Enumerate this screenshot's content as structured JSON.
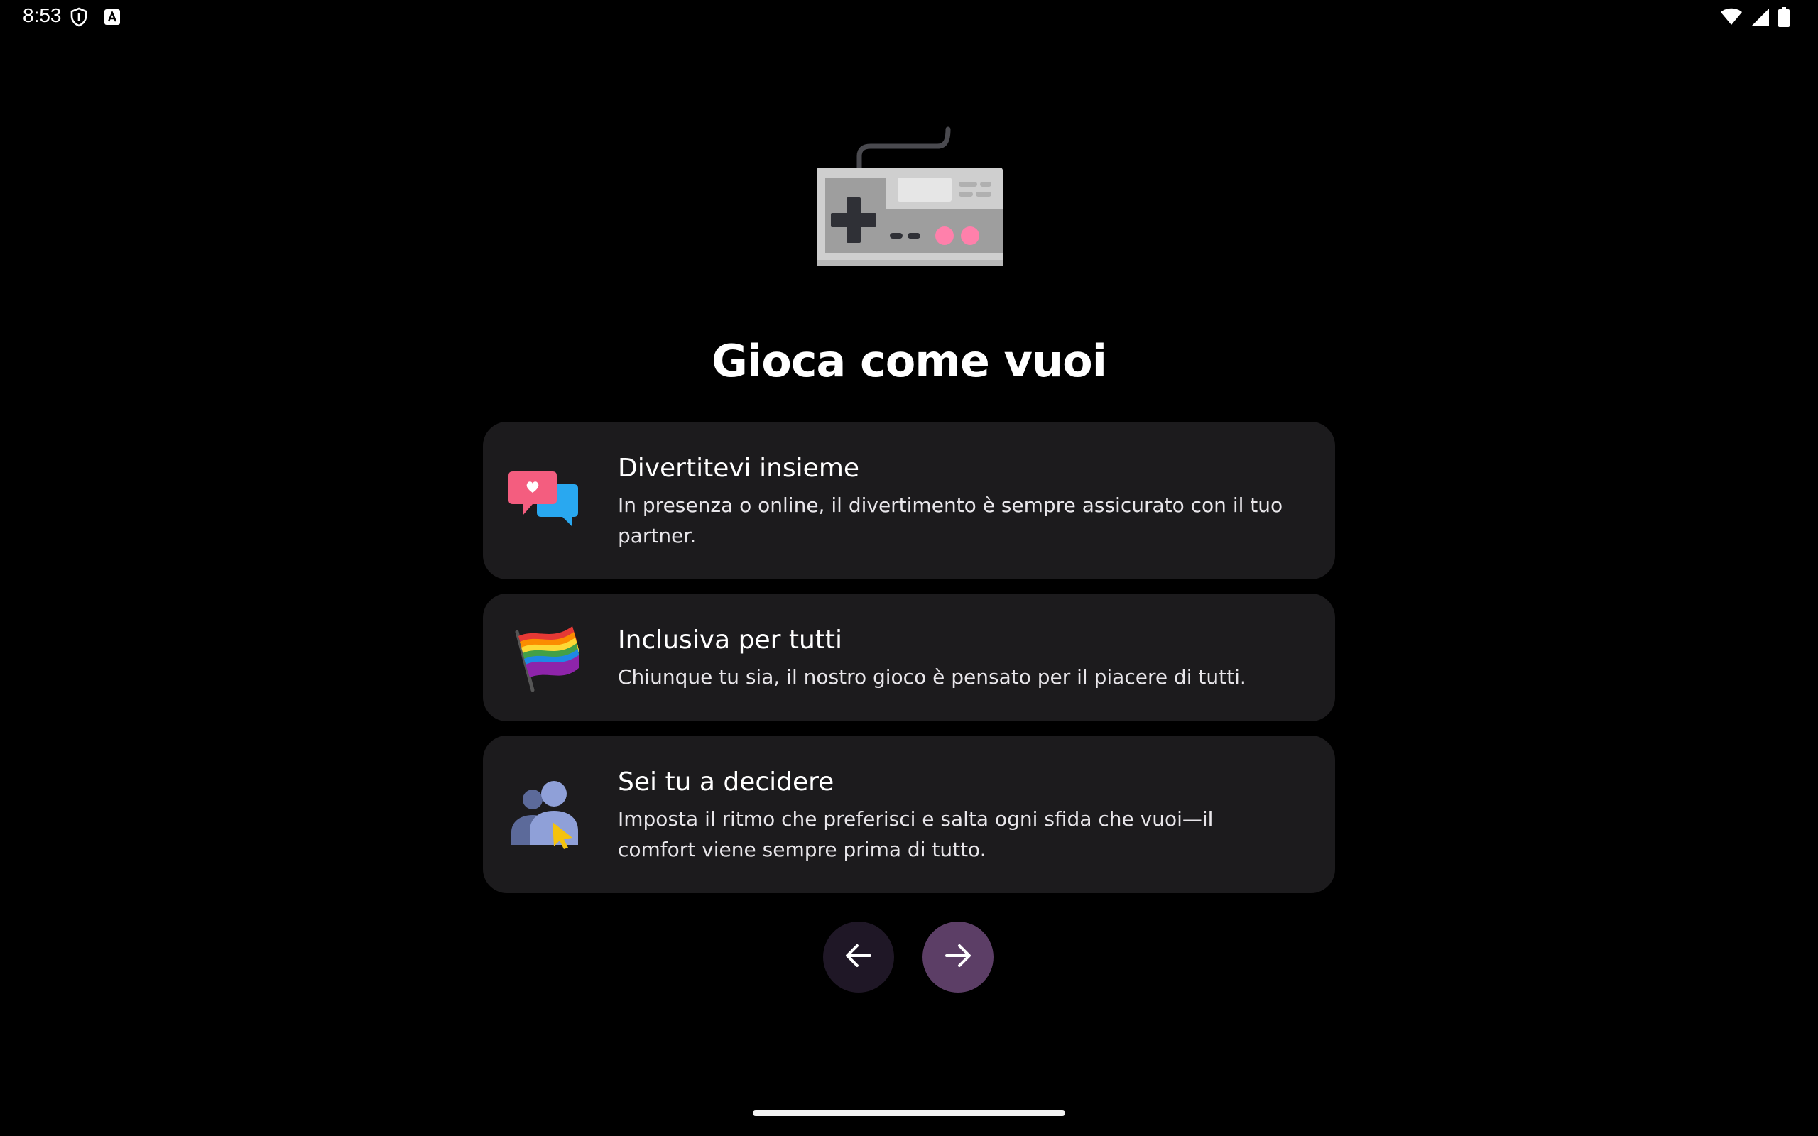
{
  "status_bar": {
    "time": "8:53",
    "left_icons": [
      "shield-icon",
      "keyboard-a-icon"
    ],
    "right_icons": [
      "wifi-icon",
      "signal-icon",
      "battery-icon"
    ]
  },
  "hero": {
    "icon": "game-controller-icon",
    "title": "Gioca come vuoi"
  },
  "features": [
    {
      "icon": "chat-bubbles-icon",
      "title": "Divertitevi insieme",
      "description": "In presenza o online, il divertimento è sempre assicurato con il tuo partner."
    },
    {
      "icon": "rainbow-flag-icon",
      "title": "Inclusiva per tutti",
      "description": "Chiunque tu sia, il nostro gioco è pensato per il piacere di tutti."
    },
    {
      "icon": "people-choice-icon",
      "title": "Sei tu a decidere",
      "description": "Imposta il ritmo che preferisci e salta ogni sfida che vuoi—il comfort viene sempre prima di tutto."
    }
  ],
  "navigation": {
    "back_icon": "arrow-left-icon",
    "next_icon": "arrow-right-icon"
  },
  "colors": {
    "background": "#000000",
    "card": "#1c1b1d",
    "back_button": "#1f1726",
    "next_button": "#5c3e66",
    "controller_button": "#ff80ab"
  }
}
